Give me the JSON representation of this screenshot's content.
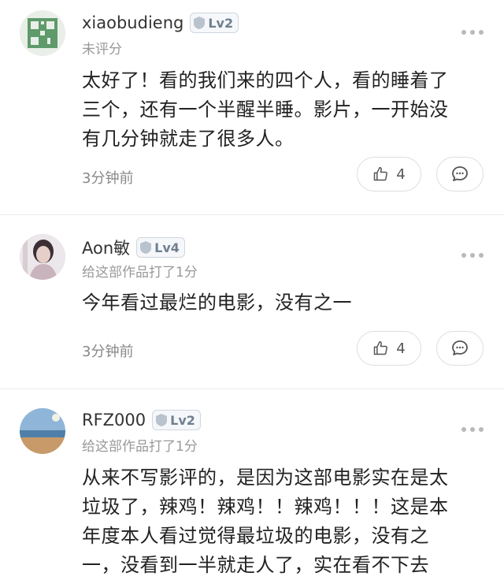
{
  "comments": [
    {
      "username": "xiaobudieng",
      "level": "Lv2",
      "rating": "未评分",
      "lines": [
        "太好了！看的我们来的四个人，看的睡着了",
        "三个，还有一个半醒半睡。影片，一开始没",
        "有几分钟就走了很多人。"
      ],
      "time": "3分钟前",
      "likes": "4"
    },
    {
      "username": "Aon敏",
      "level": "Lv4",
      "rating": "给这部作品打了1分",
      "lines": [
        "今年看过最烂的电影，没有之一"
      ],
      "time": "3分钟前",
      "likes": "4"
    },
    {
      "username": "RFZ000",
      "level": "Lv2",
      "rating": "给这部作品打了1分",
      "lines": [
        "从来不写影评的，是因为这部电影实在是太",
        "垃圾了，辣鸡！辣鸡！！辣鸡！！！这是本",
        "年度本人看过觉得最垃圾的电影，没有之",
        "一，没看到一半就走人了，实在看不下去"
      ]
    }
  ],
  "colors": {
    "muted": "#999999",
    "border": "#dddddd",
    "level_text": "#6f7f8f"
  }
}
